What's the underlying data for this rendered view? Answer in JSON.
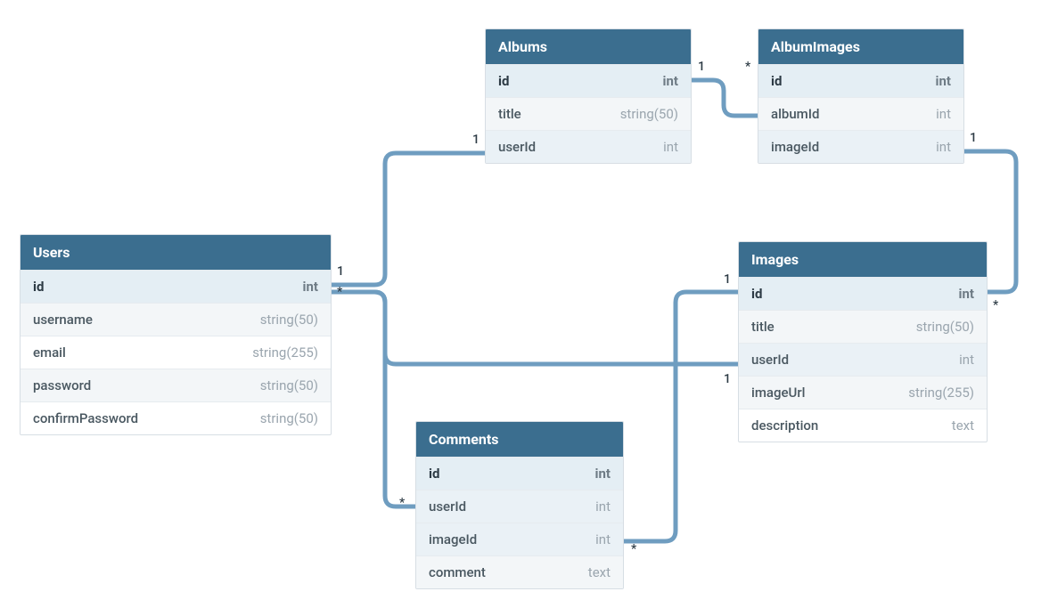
{
  "entities": {
    "users": {
      "title": "Users",
      "fields": [
        {
          "name": "id",
          "type": "int",
          "pk": true
        },
        {
          "name": "username",
          "type": "string(50)"
        },
        {
          "name": "email",
          "type": "string(255)"
        },
        {
          "name": "password",
          "type": "string(50)"
        },
        {
          "name": "confirmPassword",
          "type": "string(50)"
        }
      ]
    },
    "albums": {
      "title": "Albums",
      "fields": [
        {
          "name": "id",
          "type": "int",
          "pk": true
        },
        {
          "name": "title",
          "type": "string(50)"
        },
        {
          "name": "userId",
          "type": "int",
          "fk": true
        }
      ]
    },
    "albumImages": {
      "title": "AlbumImages",
      "fields": [
        {
          "name": "id",
          "type": "int",
          "pk": true
        },
        {
          "name": "albumId",
          "type": "int"
        },
        {
          "name": "imageId",
          "type": "int",
          "fk": true
        }
      ]
    },
    "images": {
      "title": "Images",
      "fields": [
        {
          "name": "id",
          "type": "int",
          "pk": true
        },
        {
          "name": "title",
          "type": "string(50)"
        },
        {
          "name": "userId",
          "type": "int",
          "fk": true
        },
        {
          "name": "imageUrl",
          "type": "string(255)"
        },
        {
          "name": "description",
          "type": "text"
        }
      ]
    },
    "comments": {
      "title": "Comments",
      "fields": [
        {
          "name": "id",
          "type": "int",
          "pk": true
        },
        {
          "name": "userId",
          "type": "int",
          "fk": true
        },
        {
          "name": "imageId",
          "type": "int",
          "fk": true
        },
        {
          "name": "comment",
          "type": "text"
        }
      ]
    }
  },
  "relationships": [
    {
      "from": "Users.id",
      "to": "Albums.userId",
      "from_card": "1",
      "to_card": "*"
    },
    {
      "from": "Users.id",
      "to": "Images.userId",
      "from_card": "1",
      "to_card": "*"
    },
    {
      "from": "Users.id",
      "to": "Comments.userId",
      "from_card": "1",
      "to_card": "*"
    },
    {
      "from": "Albums.id",
      "to": "AlbumImages.albumId",
      "from_card": "1",
      "to_card": "*"
    },
    {
      "from": "Images.id",
      "to": "AlbumImages.imageId",
      "from_card": "1",
      "to_card": "*"
    },
    {
      "from": "Images.id",
      "to": "Comments.imageId",
      "from_card": "1",
      "to_card": "*"
    }
  ],
  "labels": {
    "one": "1",
    "many": "*"
  }
}
